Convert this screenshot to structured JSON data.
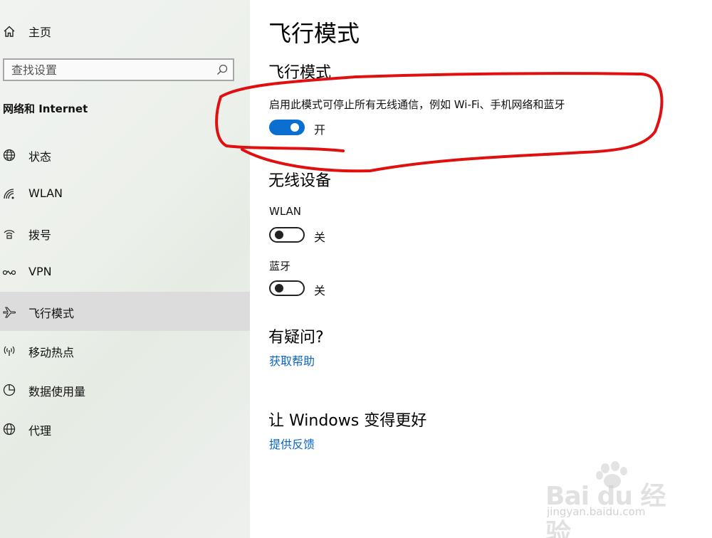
{
  "sidebar": {
    "home_label": "主页",
    "search_placeholder": "查找设置",
    "section_title": "网络和 Internet",
    "items": [
      {
        "label": "状态",
        "icon": "globe-status-icon"
      },
      {
        "label": "WLAN",
        "icon": "wifi-icon"
      },
      {
        "label": "拨号",
        "icon": "dialup-icon"
      },
      {
        "label": "VPN",
        "icon": "vpn-icon"
      },
      {
        "label": "飞行模式",
        "icon": "airplane-icon",
        "active": true
      },
      {
        "label": "移动热点",
        "icon": "hotspot-icon"
      },
      {
        "label": "数据使用量",
        "icon": "data-usage-icon"
      },
      {
        "label": "代理",
        "icon": "proxy-globe-icon"
      }
    ]
  },
  "main": {
    "page_title": "飞行模式",
    "airplane": {
      "heading": "飞行模式",
      "description": "启用此模式可停止所有无线通信，例如 Wi-Fi、手机网络和蓝牙",
      "toggle_on": true,
      "toggle_state": "开"
    },
    "wireless": {
      "heading": "无线设备",
      "wlan_label": "WLAN",
      "wlan_on": false,
      "wlan_state": "关",
      "bluetooth_label": "蓝牙",
      "bluetooth_on": false,
      "bluetooth_state": "关"
    },
    "help": {
      "heading": "有疑问?",
      "link": "获取帮助"
    },
    "feedback": {
      "heading": "让 Windows 变得更好",
      "link": "提供反馈"
    }
  },
  "watermark": {
    "logo": "Bai du 经验",
    "url": "jingyan.baidu.com"
  },
  "colors": {
    "accent": "#0a6fd1",
    "link": "#0a64c2",
    "annotation": "#e01010",
    "active_nav": "#dcdcdc"
  }
}
